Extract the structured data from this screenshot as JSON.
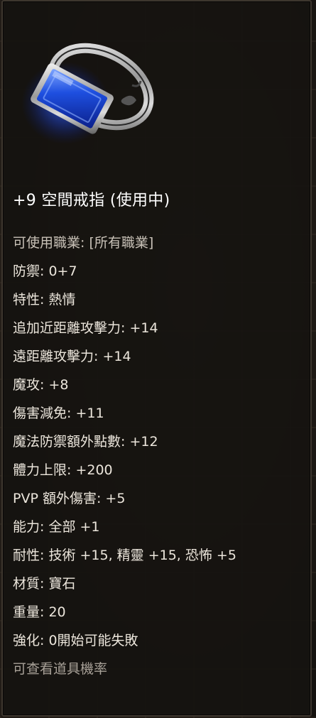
{
  "item": {
    "icon": "sapphire-ring-icon",
    "name": "+9 空間戒指 (使用中)"
  },
  "stats": [
    "可使用職業: [所有職業]",
    "防禦: 0+7",
    "特性: 熱情",
    "追加近距離攻擊力: +14",
    "遠距離攻擊力: +14",
    "魔攻: +8",
    "傷害減免: +11",
    "魔法防禦額外點數: +12",
    "體力上限: +200",
    "PVP 額外傷害: +5",
    "能力: 全部 +1",
    "耐性: 技術 +15, 精靈 +15, 恐怖 +5",
    "材質: 寶石",
    "重量: 20",
    "強化: 0開始可能失敗",
    "可查看道具機率"
  ],
  "colors": {
    "tooltip_bg": "#161310",
    "text": "#ece6dc",
    "gem": "#1e4fe0"
  }
}
